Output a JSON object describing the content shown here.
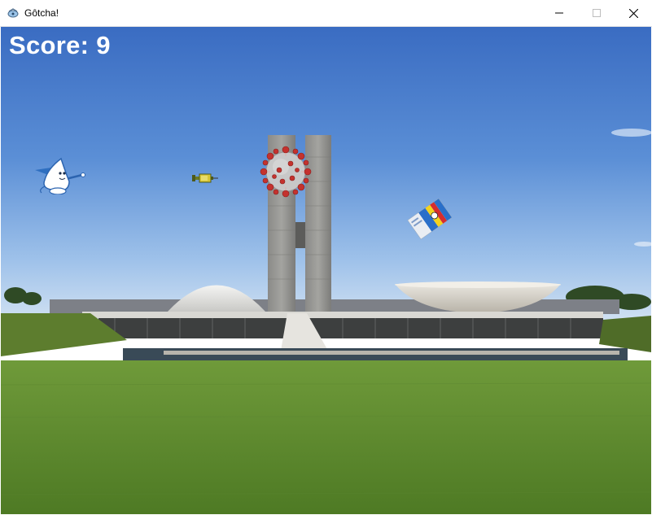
{
  "window": {
    "title": "Gôtcha!",
    "icon": "game-app-icon",
    "controls": [
      "minimize-icon",
      "maximize-icon",
      "close-icon"
    ]
  },
  "hud": {
    "score_text": "Score: 9"
  },
  "sprites": [
    {
      "name": "water-drop-hero",
      "icon": "flying-drop-character-icon"
    },
    {
      "name": "vaccine-syringe",
      "icon": "syringe-icon"
    },
    {
      "name": "coronavirus-enemy",
      "icon": "virus-icon"
    },
    {
      "name": "medicine-box",
      "icon": "medicine-box-icon"
    }
  ],
  "background": {
    "scene": "national-congress-brasilia",
    "colors": {
      "sky_top": "#3c70c4",
      "sky_bottom": "#bcd6ee",
      "grass": "#5f8c2d"
    }
  }
}
